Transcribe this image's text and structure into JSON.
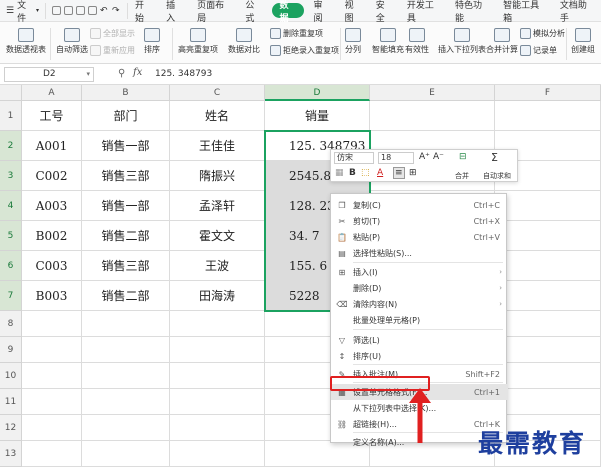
{
  "menubar": {
    "file_label": "文件",
    "tabs": [
      {
        "label": "开始",
        "active": false
      },
      {
        "label": "插入",
        "active": false
      },
      {
        "label": "页面布局",
        "active": false
      },
      {
        "label": "公式",
        "active": false
      },
      {
        "label": "数据",
        "active": true
      },
      {
        "label": "审阅",
        "active": false
      },
      {
        "label": "视图",
        "active": false
      },
      {
        "label": "安全",
        "active": false
      },
      {
        "label": "开发工具",
        "active": false
      },
      {
        "label": "特色功能",
        "active": false
      },
      {
        "label": "智能工具箱",
        "active": false
      },
      {
        "label": "文档助手",
        "active": false
      }
    ]
  },
  "ribbon": {
    "pivot": "数据透视表",
    "autofilter": "自动筛选",
    "show_all": "全部显示",
    "reapply": "重新应用",
    "sort": "排序",
    "highlight_dup": "高亮重复项",
    "data_compare": "数据对比",
    "remove_dup": "删除重复项",
    "reject_dup": "拒绝录入重复项",
    "split": "分列",
    "fill": "智能填充",
    "validity": "有效性",
    "dropdown": "插入下拉列表",
    "merge_calc": "合并计算",
    "simulate": "模拟分析",
    "record": "记录单",
    "create_group": "创建组"
  },
  "formula_bar": {
    "cell_ref": "D2",
    "fx": "fx",
    "value": "125. 348793"
  },
  "sheet": {
    "columns": [
      "A",
      "B",
      "C",
      "D",
      "E",
      "F"
    ],
    "rows": [
      "1",
      "2",
      "3",
      "4",
      "5",
      "6",
      "7",
      "8",
      "9",
      "10",
      "11",
      "12",
      "13"
    ],
    "header": [
      "工号",
      "部门",
      "姓名",
      "销量"
    ],
    "data": [
      [
        "A001",
        "销售一部",
        "王佳佳",
        "125. 348793"
      ],
      [
        "C002",
        "销售三部",
        "隋振兴",
        "2545.8"
      ],
      [
        "A003",
        "销售一部",
        "孟泽轩",
        "128. 23"
      ],
      [
        "B002",
        "销售二部",
        "霍文文",
        "34. 7"
      ],
      [
        "C003",
        "销售三部",
        "王波",
        "155. 6"
      ],
      [
        "B003",
        "销售二部",
        "田海涛",
        "5228"
      ]
    ]
  },
  "mini_toolbar": {
    "font": "仿宋",
    "size": "18",
    "merge": "合并",
    "autosum": "自动求和"
  },
  "context_menu": {
    "items": [
      {
        "icon": "copy-icon",
        "glyph": "❐",
        "label": "复制(C)",
        "key": "Ctrl+C"
      },
      {
        "icon": "cut-icon",
        "glyph": "✂",
        "label": "剪切(T)",
        "key": "Ctrl+X"
      },
      {
        "icon": "paste-icon",
        "glyph": "📋",
        "label": "粘贴(P)",
        "key": "Ctrl+V"
      },
      {
        "icon": "paste-special-icon",
        "glyph": "▤",
        "label": "选择性粘贴(S)...",
        "key": ""
      },
      {
        "icon": "insert-icon",
        "glyph": "⊞",
        "label": "插入(I)",
        "key": ""
      },
      {
        "icon": "",
        "glyph": "",
        "label": "删除(D)",
        "key": ""
      },
      {
        "icon": "clear-icon",
        "glyph": "⌫",
        "label": "清除内容(N)",
        "key": ""
      },
      {
        "icon": "",
        "glyph": "",
        "label": "批量处理单元格(P)",
        "key": ""
      },
      {
        "icon": "filter-icon",
        "glyph": "▽",
        "label": "筛选(L)",
        "key": ""
      },
      {
        "icon": "sort-icon",
        "glyph": "↕",
        "label": "排序(U)",
        "key": ""
      },
      {
        "icon": "comment-icon",
        "glyph": "✎",
        "label": "插入批注(M)...",
        "key": "Shift+F2"
      },
      {
        "icon": "format-cells-icon",
        "glyph": "▦",
        "label": "设置单元格格式(F)...",
        "key": "Ctrl+1"
      },
      {
        "icon": "",
        "glyph": "",
        "label": "从下拉列表中选择(K)...",
        "key": ""
      },
      {
        "icon": "hyperlink-icon",
        "glyph": "⛓",
        "label": "超链接(H)...",
        "key": "Ctrl+K"
      },
      {
        "icon": "",
        "glyph": "",
        "label": "定义名称(A)...",
        "key": ""
      }
    ]
  },
  "watermark": "最需教育",
  "colors": {
    "accent": "#1ba260",
    "highlight_box": "#e02020",
    "watermark": "#1e3f9e"
  }
}
